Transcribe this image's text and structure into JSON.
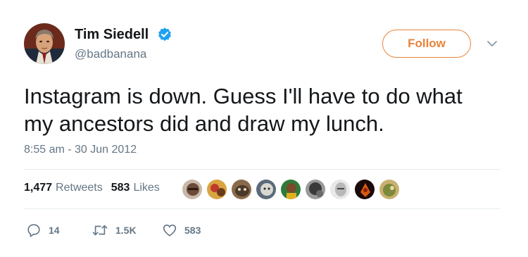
{
  "user": {
    "display_name": "Tim Siedell",
    "handle": "@badbanana",
    "verified": true
  },
  "follow_button": {
    "label": "Follow",
    "color": "#e8833a"
  },
  "menu": {
    "icon": "chevron-down-icon"
  },
  "tweet": {
    "text_line1": "Instagram is down. Guess I'll have to do what",
    "text_line2": "my ancestors did and draw my lunch.",
    "timestamp": "8:55 am - 30 Jun 2012"
  },
  "stats": {
    "retweets_count": "1,477",
    "retweets_label": "Retweets",
    "likes_count": "583",
    "likes_label": "Likes"
  },
  "liker_avatars": [
    {
      "name": "liker-avatar-1",
      "color": "#6b4a3a"
    },
    {
      "name": "liker-avatar-2",
      "color": "#c0392b"
    },
    {
      "name": "liker-avatar-3",
      "color": "#4a3a2a"
    },
    {
      "name": "liker-avatar-4",
      "color": "#8a8f95"
    },
    {
      "name": "liker-avatar-5",
      "color": "#2f7a3a"
    },
    {
      "name": "liker-avatar-6",
      "color": "#3a3a3a"
    },
    {
      "name": "liker-avatar-7",
      "color": "#b8b8b8"
    },
    {
      "name": "liker-avatar-8",
      "color": "#8b1e10"
    },
    {
      "name": "liker-avatar-9",
      "color": "#7a8a3a"
    }
  ],
  "actions": {
    "reply": {
      "icon": "reply-icon",
      "count": "14"
    },
    "retweet": {
      "icon": "retweet-icon",
      "count": "1.5K"
    },
    "like": {
      "icon": "heart-icon",
      "count": "583"
    }
  },
  "colors": {
    "text": "#14171a",
    "secondary": "#657786",
    "verified": "#1da1f2",
    "divider": "#e6ecf0"
  }
}
